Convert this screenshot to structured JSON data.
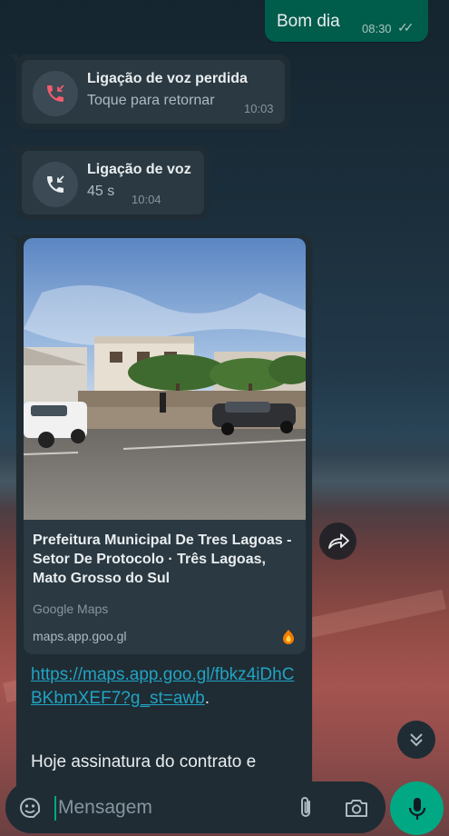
{
  "outgoing": {
    "text": "Bom dia",
    "time": "08:30",
    "status_icon": "double-check-icon"
  },
  "missed_call": {
    "title": "Ligação de voz perdida",
    "subtitle": "Toque para retornar",
    "time": "10:03",
    "icon": "missed-call-icon",
    "icon_color": "#f15c6d"
  },
  "voice_call": {
    "title": "Ligação de voz",
    "subtitle": "45 s",
    "time": "10:04",
    "icon": "incoming-call-icon"
  },
  "link_preview": {
    "title": "Prefeitura Municipal De Tres Lagoas - Setor De Protocolo · Três Lagoas, Mato Grosso do Sul",
    "source": "Google Maps",
    "domain": "maps.app.goo.gl",
    "link": "https://maps.app.goo.gl/fbkz4iDhCBKbmXEF7?g_st=awb",
    "link_suffix": ".",
    "body": "Hoje assinatura do contrato e"
  },
  "composer": {
    "placeholder": "Mensagem"
  },
  "colors": {
    "accent": "#00a884",
    "incoming_bubble": "#1f2c34",
    "outgoing_bubble": "#005c4b",
    "link": "#21a3c2"
  }
}
